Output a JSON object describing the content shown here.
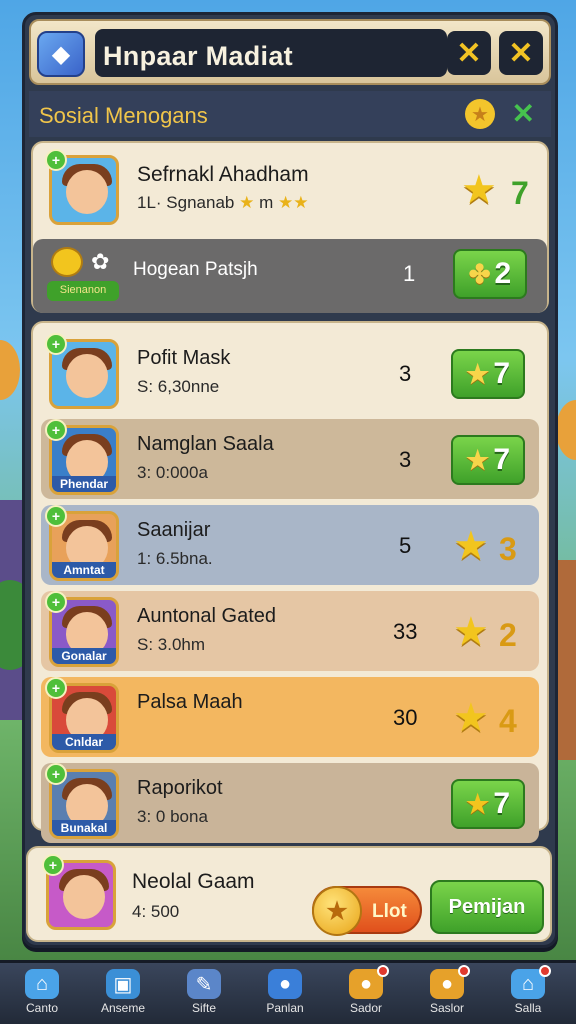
{
  "header": {
    "title": "Hnpaar Madiat",
    "btn1": "✕",
    "btn2": "✕"
  },
  "section": {
    "title": "Sosial Menogans"
  },
  "top_card": {
    "player": {
      "name": "Sefrnakl Ahadham",
      "sub": "1L· Sgnanab",
      "sub2": "m",
      "score": "7"
    },
    "reward_row": {
      "label": "Hogean Patsjh",
      "badge": "Sienanon",
      "count": "1",
      "btn_value": "2"
    }
  },
  "list": [
    {
      "name": "Pofit Mask",
      "sub": "S: 6,30nne",
      "count": "3",
      "value": "7",
      "badge": "",
      "style": "green"
    },
    {
      "name": "Namglan Saala",
      "sub": "3: 0:000a",
      "count": "3",
      "value": "7",
      "badge": "Phendar",
      "style": "green"
    },
    {
      "name": "Saanijar",
      "sub": "1: 6.5bna.",
      "count": "5",
      "value": "3",
      "badge": "Amntat",
      "style": "gold"
    },
    {
      "name": "Auntonal Gated",
      "sub": "S: 3.0hm",
      "count": "33",
      "value": "2",
      "badge": "Gonalar",
      "style": "gold"
    },
    {
      "name": "Palsa Maah",
      "sub": "",
      "count": "30",
      "value": "4",
      "badge": "Cnldar",
      "style": "gold"
    },
    {
      "name": "Raporikot",
      "sub": "3: 0 bona",
      "count": "",
      "value": "7",
      "badge": "Bunakal",
      "style": "gold"
    }
  ],
  "self": {
    "name": "Neolal Gaam",
    "sub": "4: 500",
    "coin_btn": "Llot",
    "play_btn": "Pemijan"
  },
  "nav": [
    {
      "label": "Canto",
      "icon": "⌂",
      "color": "#4aa3e8",
      "dot": false
    },
    {
      "label": "Anseme",
      "icon": "▣",
      "color": "#3b8fd6",
      "dot": false
    },
    {
      "label": "Sifte",
      "icon": "✎",
      "color": "#5b86c9",
      "dot": false
    },
    {
      "label": "Panlan",
      "icon": "●",
      "color": "#3a7fd9",
      "dot": false
    },
    {
      "label": "Sador",
      "icon": "●",
      "color": "#e6a12a",
      "dot": true
    },
    {
      "label": "Saslor",
      "icon": "●",
      "color": "#e6a12a",
      "dot": true
    },
    {
      "label": "Salla",
      "icon": "⌂",
      "color": "#4aa3e8",
      "dot": true
    }
  ]
}
